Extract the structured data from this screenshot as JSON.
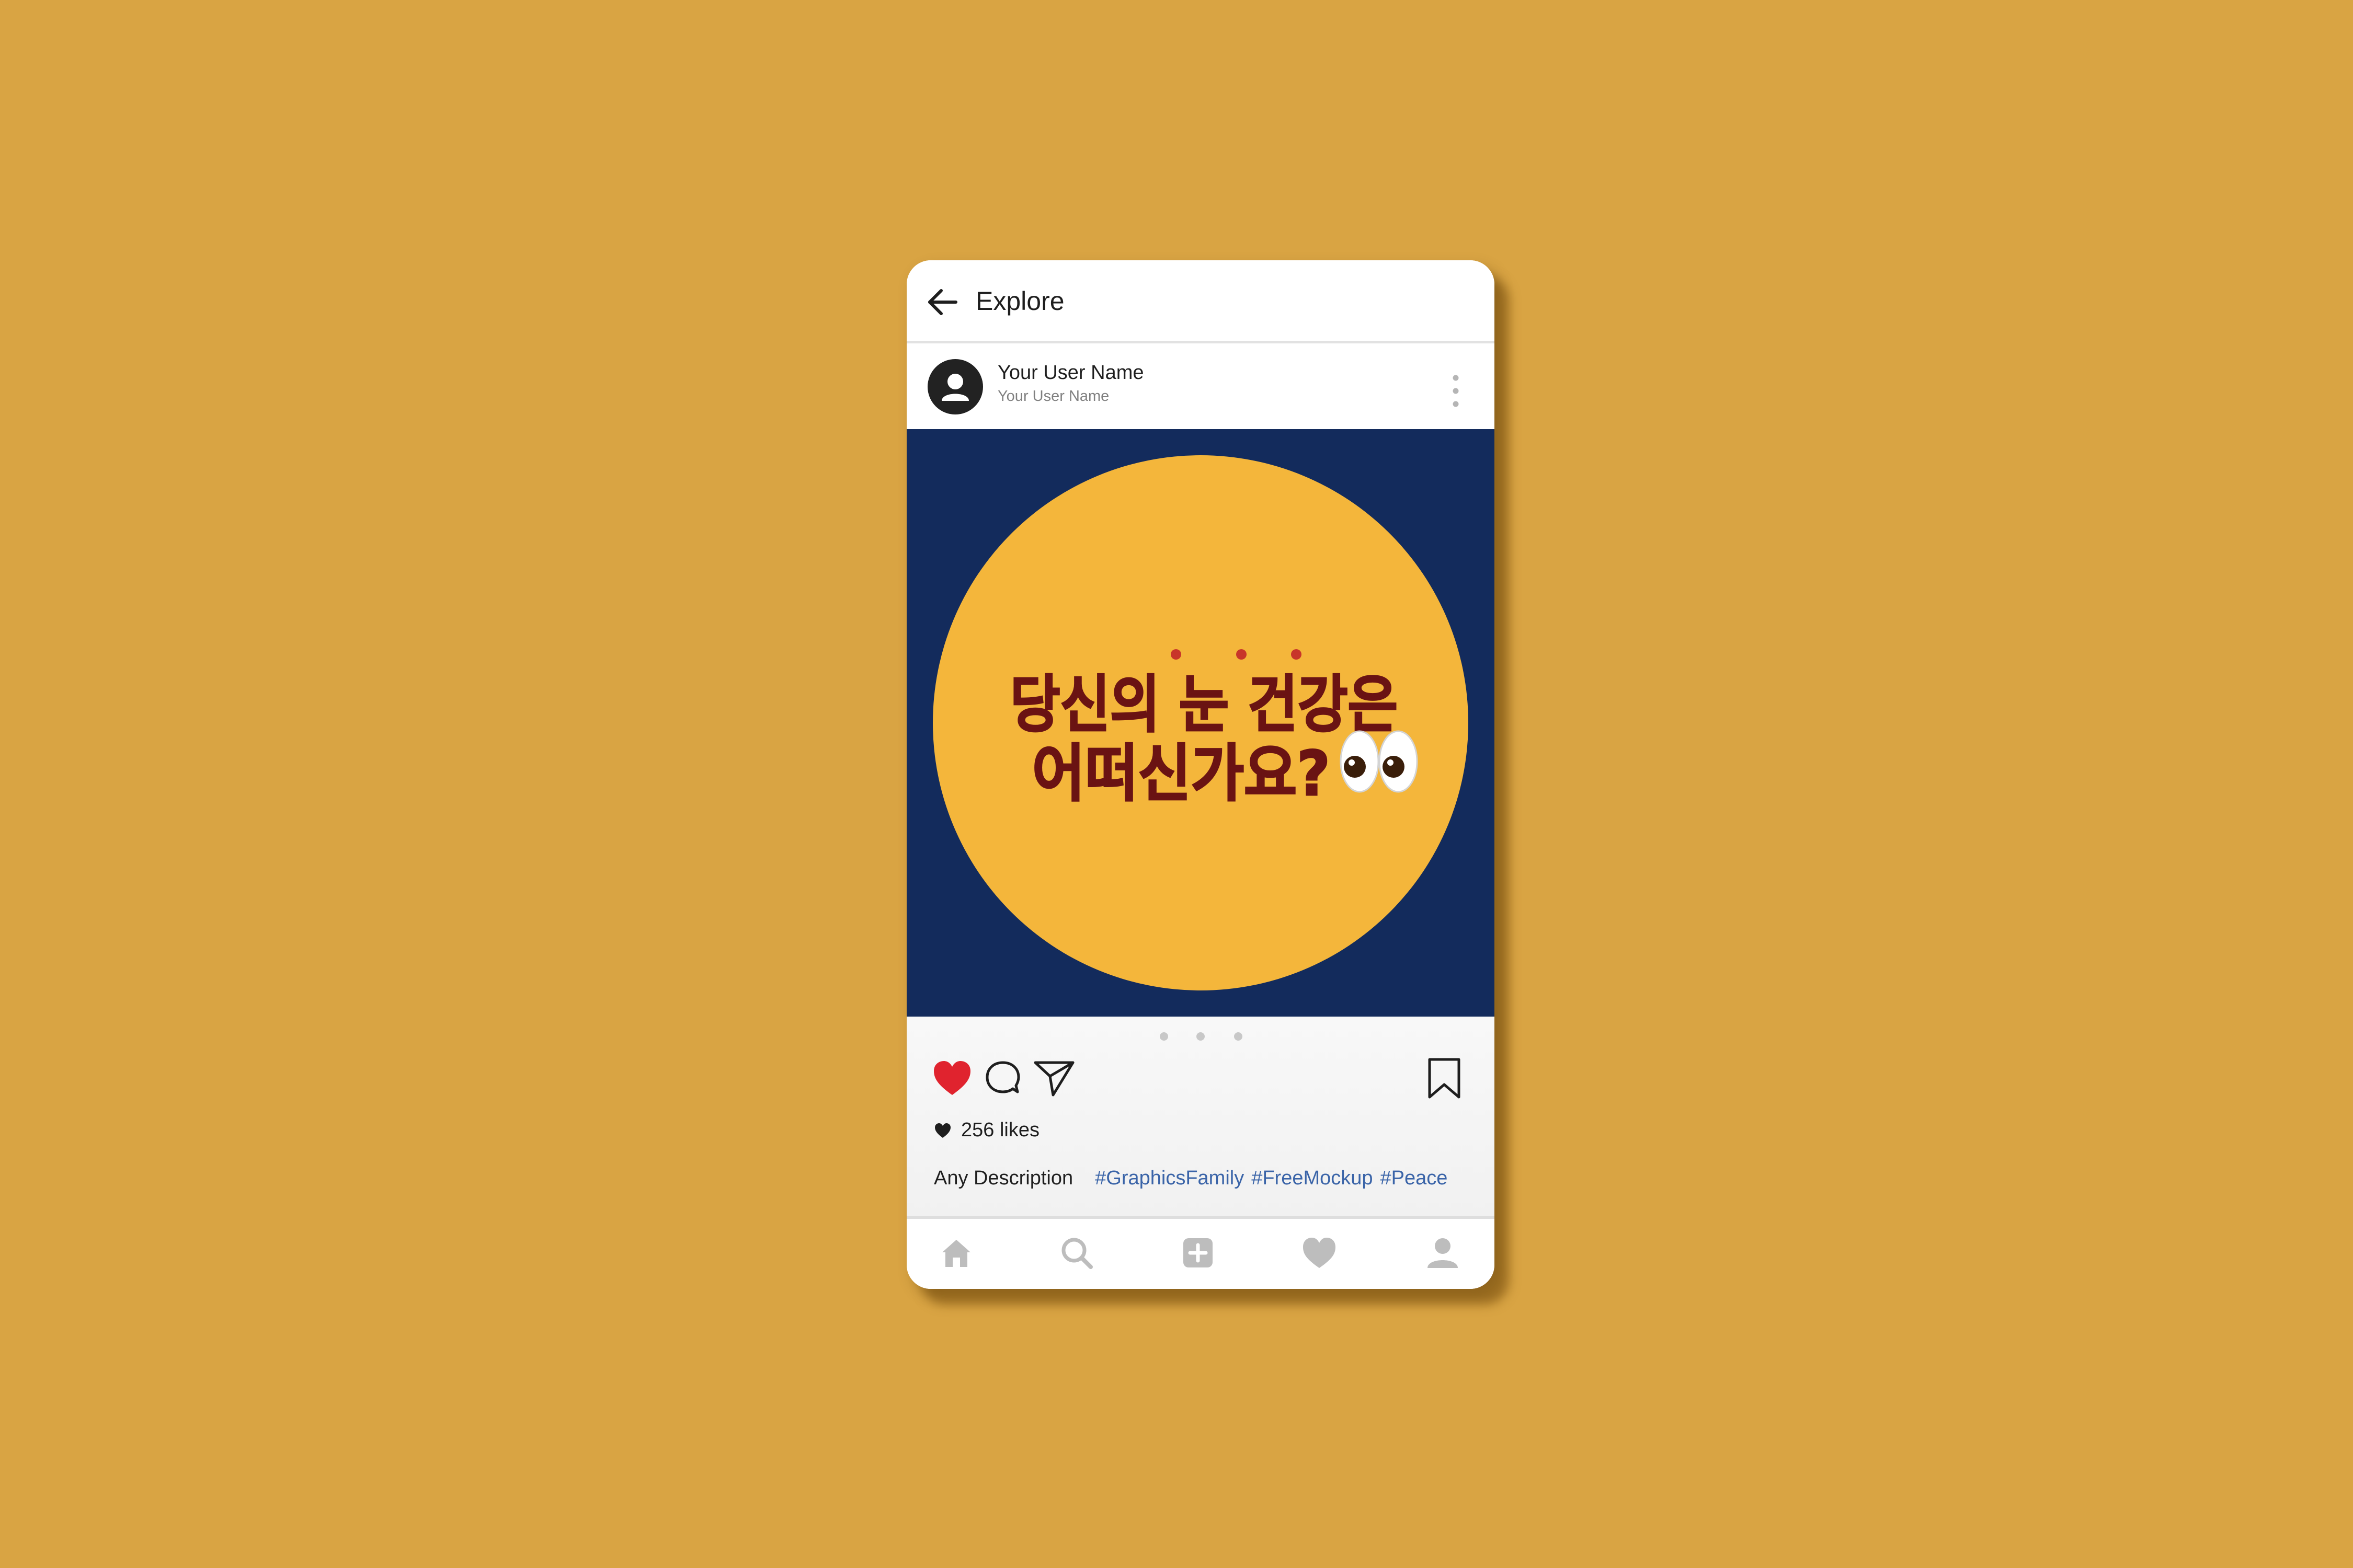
{
  "colors": {
    "background": "#D9A443",
    "post_background": "#132B5C",
    "post_circle": "#F4B63B",
    "post_text": "#6A1313",
    "accent_dots": "#C8352A",
    "liked_heart": "#E0232E",
    "hashtag": "#3A64A8",
    "nav_icon": "#bdbdbd"
  },
  "header": {
    "back_icon": "arrow-left-icon",
    "title": "Explore"
  },
  "profile": {
    "avatar_icon": "user-silhouette-icon",
    "username": "Your User Name",
    "subtitle": "Your User Name",
    "menu_icon": "vertical-dots-icon"
  },
  "post": {
    "headline_line1": "당신의 눈 건강은",
    "headline_line2": "어떠신가요?",
    "decoration_icon": "eyes-emoji-icon",
    "carousel_pages": 3
  },
  "actions": {
    "like_icon": "heart-filled-icon",
    "liked": true,
    "comment_icon": "comment-bubble-icon",
    "share_icon": "paper-plane-icon",
    "save_icon": "bookmark-icon"
  },
  "likes": {
    "icon": "heart-small-icon",
    "text": "256 likes"
  },
  "caption": {
    "description": "Any Description",
    "hashtags": [
      "#GraphicsFamily",
      "#FreeMockup",
      "#Peace"
    ]
  },
  "bottom_nav": {
    "items": [
      "home-icon",
      "search-icon",
      "add-post-icon",
      "activity-heart-icon",
      "profile-icon"
    ]
  }
}
